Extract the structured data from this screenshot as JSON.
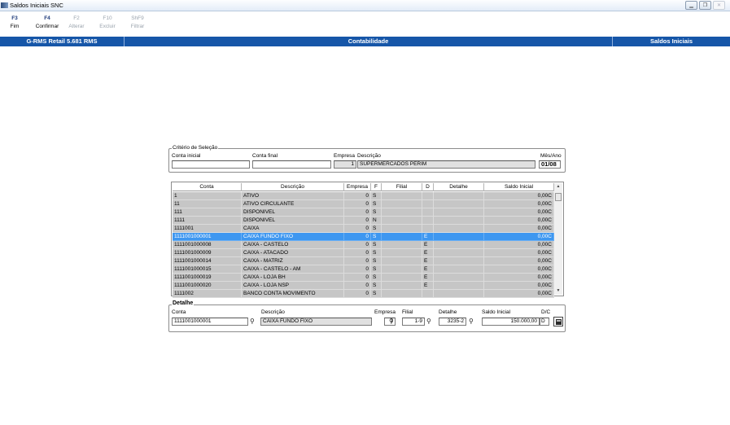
{
  "window": {
    "title": "Saldos Iniciais SNC"
  },
  "toolbar": [
    {
      "key": "F3",
      "label": "Fim",
      "enabled": true
    },
    {
      "key": "F4",
      "label": "Confirmar",
      "enabled": true
    },
    {
      "key": "F2",
      "label": "Alterar",
      "enabled": false
    },
    {
      "key": "F10",
      "label": "Excluir",
      "enabled": false
    },
    {
      "key": "ShF9",
      "label": "Filtrar",
      "enabled": false
    }
  ],
  "header": {
    "app": "G-RMS Retail 5.681 RMS",
    "module": "Contabilidade",
    "screen": "Saldos Iniciais"
  },
  "criteria": {
    "legend": "Critério de Seleção",
    "conta_inicial_label": "Conta inicial",
    "conta_final_label": "Conta final",
    "empresa_label": "Empresa",
    "descricao_label": "Descrição",
    "mes_ano_label": "Mês/Ano",
    "conta_inicial": "",
    "conta_final": "",
    "empresa": "1",
    "descricao": "SUPERMERCADOS PERIM",
    "mes_ano": "01/08"
  },
  "grid": {
    "columns": [
      "Conta",
      "Descrição",
      "Empresa",
      "F",
      "Filial",
      "D",
      "Detalhe",
      "Saldo Inicial"
    ],
    "rows": [
      [
        "1",
        "ATIVO",
        "0",
        "S",
        "",
        "",
        "",
        "0,00C"
      ],
      [
        "11",
        "ATIVO CIRCULANTE",
        "0",
        "S",
        "",
        "",
        "",
        "0,00C"
      ],
      [
        "111",
        "DISPONIVEL",
        "0",
        "S",
        "",
        "",
        "",
        "0,00C"
      ],
      [
        "1111",
        "DISPONIVEL",
        "0",
        "N",
        "",
        "",
        "",
        "0,00C"
      ],
      [
        "1111001",
        "CAIXA",
        "0",
        "S",
        "",
        "",
        "",
        "0,00C"
      ],
      [
        "1111001000001",
        "CAIXA FUNDO FIXO",
        "0",
        "S",
        "",
        "E",
        "",
        "0,00C"
      ],
      [
        "1111001000008",
        "CAIXA - CASTELO",
        "0",
        "S",
        "",
        "E",
        "",
        "0,00C"
      ],
      [
        "1111001000009",
        "CAIXA - ATACADO",
        "0",
        "S",
        "",
        "E",
        "",
        "0,00C"
      ],
      [
        "1111001000014",
        "CAIXA - MATRIZ",
        "0",
        "S",
        "",
        "E",
        "",
        "0,00C"
      ],
      [
        "1111001000015",
        "CAIXA - CASTELO - AM",
        "0",
        "S",
        "",
        "E",
        "",
        "0,00C"
      ],
      [
        "1111001000019",
        "CAIXA - LOJA BH",
        "0",
        "S",
        "",
        "E",
        "",
        "0,00C"
      ],
      [
        "1111001000020",
        "CAIXA - LOJA NSP",
        "0",
        "S",
        "",
        "E",
        "",
        "0,00C"
      ],
      [
        "1111002",
        "BANCO CONTA MOVIMENTO",
        "0",
        "S",
        "",
        "",
        "",
        "0,00C"
      ]
    ],
    "selected_row": 5
  },
  "detail": {
    "legend": "Detalhe",
    "conta_label": "Conta",
    "descricao_label": "Descrição",
    "empresa_label": "Empresa",
    "filial_label": "Filial",
    "detalhe_label": "Detalhe",
    "saldo_label": "Saldo Inicial",
    "dc_label": "D/C",
    "conta": "1111001000001",
    "descricao": "CAIXA FUNDO FIXO",
    "empresa": "1",
    "filial": "1-9",
    "detalhe": "3235-2",
    "saldo": "150.000,00",
    "dc": "D"
  },
  "colors": {
    "header_bar": "#1656a8",
    "selection": "#3e97f0",
    "row_bg": "#c6c6c6"
  },
  "icons": [
    "binoculars-icon",
    "save-disk-icon"
  ]
}
